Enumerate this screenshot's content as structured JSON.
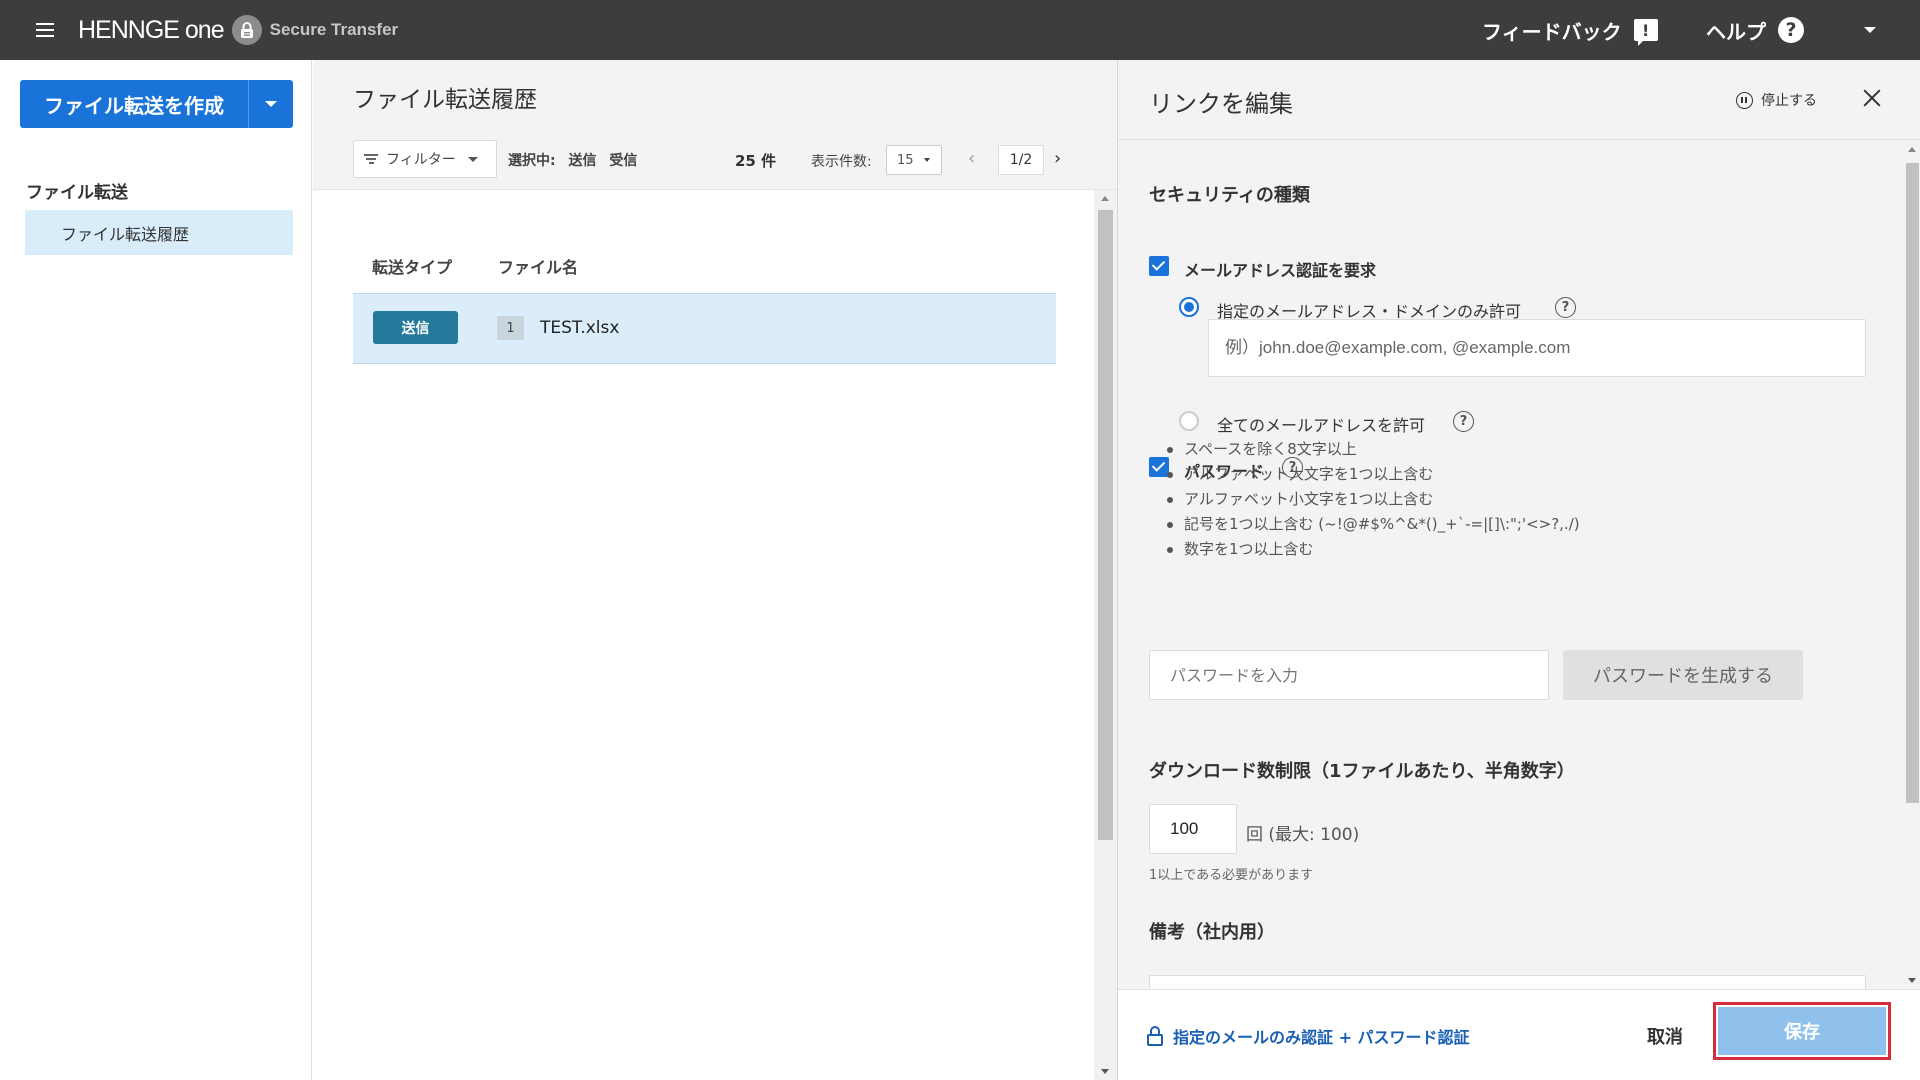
{
  "topbar": {
    "logo_text": "HENNGE one",
    "product_name": "Secure Transfer",
    "feedback_label": "フィードバック",
    "help_label": "ヘルプ"
  },
  "sidebar": {
    "create_button_label": "ファイル転送を作成",
    "section_heading": "ファイル転送",
    "items": [
      {
        "label": "ファイル転送履歴",
        "selected": true
      }
    ]
  },
  "history": {
    "title": "ファイル転送履歴",
    "filter_label": "フィルター",
    "selection_prefix": "選択中:",
    "selection_values": [
      "送信",
      "受信"
    ],
    "total_count": "25 件",
    "per_page_label": "表示件数:",
    "per_page_value": "15",
    "page_indicator": "1/2",
    "columns": [
      "転送タイプ",
      "ファイル名"
    ],
    "rows": [
      {
        "type": "送信",
        "file_count": "1",
        "file_name": "TEST.xlsx",
        "selected": true
      }
    ]
  },
  "drawer": {
    "title": "リンクを編集",
    "stop_label": "停止する",
    "security_title": "セキュリティの種類",
    "email_auth": {
      "label": "メールアドレス認証を要求",
      "checked": true,
      "option_specific": "指定のメールアドレス・ドメインのみ許可",
      "option_specific_selected": true,
      "email_placeholder": "例）john.doe@example.com, @example.com",
      "email_value": "",
      "option_all": "全てのメールアドレスを許可",
      "option_all_selected": false
    },
    "password": {
      "label": "パスワード",
      "checked": true,
      "rules": [
        "スペースを除く8文字以上",
        "アルファベット大文字を1つ以上含む",
        "アルファベット小文字を1つ以上含む",
        "記号を1つ以上含む (~!@#$%^&*()_+`-=|[]\\:\";'<>?,./)",
        "数字を1つ以上含む"
      ],
      "input_placeholder": "パスワードを入力",
      "input_value": "",
      "generate_label": "パスワードを生成する"
    },
    "download_limit": {
      "title": "ダウンロード数制限（1ファイルあたり、半角数字）",
      "value": "100",
      "unit": "回 (最大: 100)",
      "note": "1以上である必要があります"
    },
    "memo_title": "備考（社内用）",
    "footer": {
      "auth_summary": "指定のメールのみ認証 + パスワード認証",
      "cancel_label": "取消",
      "save_label": "保存"
    }
  },
  "colors": {
    "topbar_bg": "#3d3d3d",
    "primary": "#1a73d9",
    "send_badge": "#237a9a",
    "selected_row": "#dbedfa",
    "save_button": "#8fc1ec",
    "highlight_border": "#d42c3c"
  },
  "icons": [
    "menu-icon",
    "lock-badge-icon",
    "feedback-icon",
    "help-icon",
    "chevron-down-icon",
    "filter-icon",
    "chevron-left-icon",
    "chevron-right-icon",
    "pause-circle-icon",
    "close-icon",
    "question-icon",
    "lock-icon"
  ]
}
